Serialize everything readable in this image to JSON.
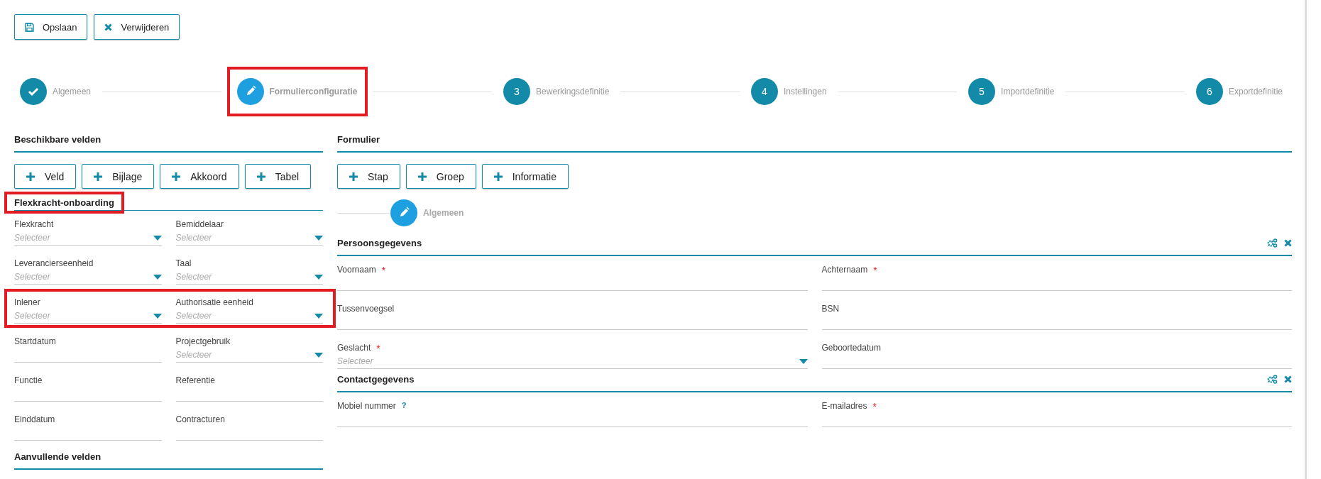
{
  "toolbar": [
    {
      "kind": "save",
      "label": "Opslaan"
    },
    {
      "kind": "delete",
      "label": "Verwijderen"
    }
  ],
  "steps": [
    {
      "label": "Algemeen",
      "done": true,
      "active": false,
      "highlighted": false
    },
    {
      "label": "Formulierconfiguratie",
      "done": false,
      "active": true,
      "highlighted": true
    },
    {
      "label": "Bewerkingsdefinitie",
      "number": "3",
      "done": false,
      "active": false,
      "highlighted": false
    },
    {
      "label": "Instellingen",
      "number": "4",
      "done": false,
      "active": false,
      "highlighted": false
    },
    {
      "label": "Importdefinitie",
      "number": "5",
      "done": false,
      "active": false,
      "highlighted": false
    },
    {
      "label": "Exportdefinitie",
      "number": "6",
      "done": false,
      "active": false,
      "highlighted": false
    }
  ],
  "available": {
    "title": "Beschikbare velden",
    "buttons": [
      "Veld",
      "Bijlage",
      "Akkoord",
      "Tabel"
    ],
    "group": {
      "title": "Flexkracht-onboarding",
      "highlighted": true,
      "rows": [
        {
          "highlighted": false,
          "fields": [
            {
              "label": "Flexkracht",
              "kind": "select",
              "placeholder": "Selecteer"
            },
            {
              "label": "Bemiddelaar",
              "kind": "select",
              "placeholder": "Selecteer"
            }
          ]
        },
        {
          "highlighted": false,
          "fields": [
            {
              "label": "Leverancierseenheid",
              "kind": "select",
              "placeholder": "Selecteer"
            },
            {
              "label": "Taal",
              "kind": "select",
              "placeholder": "Selecteer"
            }
          ]
        },
        {
          "highlighted": true,
          "fields": [
            {
              "label": "Inlener",
              "kind": "select",
              "placeholder": "Selecteer"
            },
            {
              "label": "Authorisatie eenheid",
              "kind": "select",
              "placeholder": "Selecteer"
            }
          ]
        },
        {
          "highlighted": false,
          "fields": [
            {
              "label": "Startdatum",
              "kind": "text"
            },
            {
              "label": "Projectgebruik",
              "kind": "select",
              "placeholder": "Selecteer"
            }
          ]
        },
        {
          "highlighted": false,
          "fields": [
            {
              "label": "Functie",
              "kind": "text"
            },
            {
              "label": "Referentie",
              "kind": "text"
            }
          ]
        },
        {
          "highlighted": false,
          "fields": [
            {
              "label": "Einddatum",
              "kind": "text"
            },
            {
              "label": "Contracturen",
              "kind": "text"
            }
          ]
        }
      ]
    },
    "next_title": "Aanvullende velden"
  },
  "form": {
    "title": "Formulier",
    "buttons": [
      "Stap",
      "Groep",
      "Informatie"
    ],
    "step": {
      "label": "Algemeen",
      "done": false,
      "active": true
    },
    "groups": [
      {
        "title": "Persoonsgegevens",
        "rows": [
          {
            "fields": [
              {
                "label": "Voornaam",
                "kind": "text",
                "marker": {
                  "kind": "required",
                  "text": "*"
                }
              },
              {
                "label": "Achternaam",
                "kind": "text",
                "marker": {
                  "kind": "required",
                  "text": "*"
                }
              }
            ]
          },
          {
            "fields": [
              {
                "label": "Tussenvoegsel",
                "kind": "text"
              },
              {
                "label": "BSN",
                "kind": "text"
              }
            ]
          },
          {
            "fields": [
              {
                "label": "Geslacht",
                "kind": "select",
                "placeholder": "Selecteer",
                "marker": {
                  "kind": "required",
                  "text": "*"
                }
              },
              {
                "label": "Geboortedatum",
                "kind": "text"
              }
            ]
          }
        ]
      },
      {
        "title": "Contactgegevens",
        "rows": [
          {
            "fields": [
              {
                "label": "Mobiel nummer",
                "kind": "text",
                "marker": {
                  "kind": "help",
                  "text": "?"
                }
              },
              {
                "label": "E-mailadres",
                "kind": "text",
                "marker": {
                  "kind": "required",
                  "text": "*"
                }
              }
            ]
          }
        ]
      }
    ]
  }
}
